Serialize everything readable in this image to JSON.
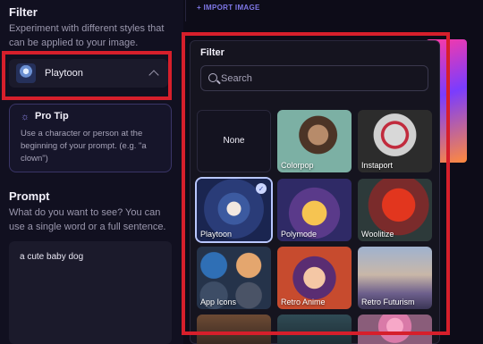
{
  "left": {
    "filter": {
      "title": "Filter",
      "description": "Experiment with different styles that can be applied to your image.",
      "selected": "Playtoon"
    },
    "protip": {
      "title": "Pro Tip",
      "text": "Use a character or person at the beginning of your prompt. (e.g. \"a clown\")"
    },
    "prompt": {
      "title": "Prompt",
      "description": "What do you want to see? You can use a single word or a full sentence.",
      "value": "a cute baby dog"
    }
  },
  "right": {
    "import_label": "+ IMPORT IMAGE"
  },
  "dropdown": {
    "title": "Filter",
    "search_placeholder": "Search",
    "tiles": [
      {
        "label": "None"
      },
      {
        "label": "Colorpop"
      },
      {
        "label": "Instaport"
      },
      {
        "label": "Playtoon",
        "selected": true
      },
      {
        "label": "Polymode"
      },
      {
        "label": "Woolitize"
      },
      {
        "label": "App Icons"
      },
      {
        "label": "Retro Anime"
      },
      {
        "label": "Retro Futurism"
      }
    ]
  },
  "colors": {
    "accent": "#7f78e8",
    "highlight_frame": "#d61f2b"
  }
}
